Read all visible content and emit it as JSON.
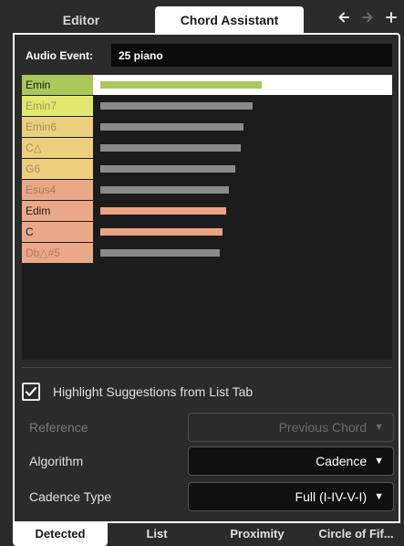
{
  "top_tabs": {
    "editor": "Editor",
    "chord_assistant": "Chord Assistant"
  },
  "nav_icons": [
    "arrow-left-icon",
    "arrow-right-icon",
    "plus-icon"
  ],
  "audio_event": {
    "label": "Audio Event:",
    "value": "25 piano"
  },
  "chords": [
    {
      "name": "Emin",
      "fraction": 0.54,
      "name_color": "#ffffff",
      "label_bg": "#a8c85a",
      "bar_color": "#a8c85a",
      "text_color": "#1a1a1a",
      "selected": true
    },
    {
      "name": "Emin7",
      "fraction": 0.51,
      "name_color": "#9a9a60",
      "label_bg": "#e2e86e",
      "bar_color": "#8a8a8a",
      "text_color": "#9a9a58",
      "selected": false
    },
    {
      "name": "Emin6",
      "fraction": 0.48,
      "name_color": "#a89060",
      "label_bg": "#ecd07e",
      "bar_color": "#8a8a8a",
      "text_color": "#a88c5a",
      "selected": false
    },
    {
      "name": "C△",
      "fraction": 0.47,
      "name_color": "#a89060",
      "label_bg": "#ecd07e",
      "bar_color": "#8a8a8a",
      "text_color": "#a88c5a",
      "selected": false
    },
    {
      "name": "G6",
      "fraction": 0.45,
      "name_color": "#a89060",
      "label_bg": "#ecd07e",
      "bar_color": "#8a8a8a",
      "text_color": "#a88c5a",
      "selected": false
    },
    {
      "name": "Esus4",
      "fraction": 0.43,
      "name_color": "#b07860",
      "label_bg": "#eaa888",
      "bar_color": "#8a8a8a",
      "text_color": "#b07860",
      "selected": false
    },
    {
      "name": "Edim",
      "fraction": 0.42,
      "name_color": "#1a1a1a",
      "label_bg": "#eaa888",
      "bar_color": "#eca283",
      "text_color": "#1a1a1a",
      "selected": false
    },
    {
      "name": "C",
      "fraction": 0.41,
      "name_color": "#1a1a1a",
      "label_bg": "#eaa888",
      "bar_color": "#eca283",
      "text_color": "#1a1a1a",
      "selected": false
    },
    {
      "name": "Db△#5",
      "fraction": 0.4,
      "name_color": "#b07860",
      "label_bg": "#eaa888",
      "bar_color": "#8a8a8a",
      "text_color": "#b07860",
      "selected": false
    }
  ],
  "highlight": {
    "label": "Highlight Suggestions from List Tab",
    "checked": true
  },
  "fields": [
    {
      "label": "Reference",
      "value": "Previous Chord",
      "enabled": false
    },
    {
      "label": "Algorithm",
      "value": "Cadence",
      "enabled": true
    },
    {
      "label": "Cadence Type",
      "value": "Full (I-IV-V-I)",
      "enabled": true
    }
  ],
  "bottom_tabs": [
    "Detected",
    "List",
    "Proximity",
    "Circle of Fif..."
  ]
}
